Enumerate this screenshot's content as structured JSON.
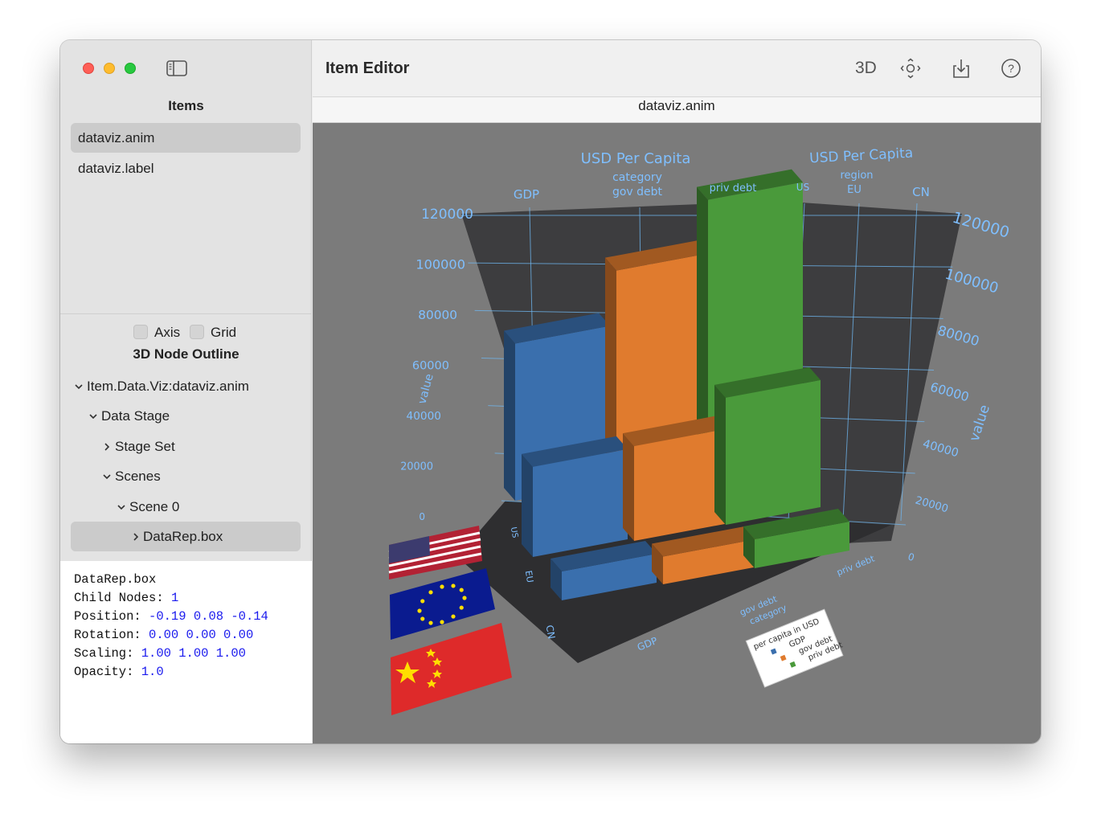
{
  "window": {
    "title": "Item Editor",
    "document_tab": "dataviz.anim"
  },
  "toolbar": {
    "title": "Item Editor",
    "mode_3d_label": "3D",
    "icons": [
      "recenter-icon",
      "export-icon",
      "help-icon"
    ]
  },
  "sidebar": {
    "items_title": "Items",
    "items": [
      {
        "label": "dataviz.anim",
        "selected": true
      },
      {
        "label": "dataviz.label",
        "selected": false
      }
    ],
    "axis_label": "Axis",
    "grid_label": "Grid",
    "axis_checked": false,
    "grid_checked": false,
    "outline_title": "3D Node Outline",
    "tree": [
      {
        "label": "Item.Data.Viz:dataviz.anim",
        "expanded": true,
        "depth": 0,
        "selected": false
      },
      {
        "label": "Data Stage",
        "expanded": true,
        "depth": 1,
        "selected": false
      },
      {
        "label": "Stage Set",
        "expanded": false,
        "depth": 2,
        "selected": false
      },
      {
        "label": "Scenes",
        "expanded": true,
        "depth": 2,
        "selected": false
      },
      {
        "label": "Scene 0",
        "expanded": true,
        "depth": 3,
        "selected": false
      },
      {
        "label": "DataRep.box",
        "expanded": false,
        "depth": 4,
        "selected": true
      }
    ]
  },
  "info": {
    "name": "DataRep.box",
    "child_nodes_label": "Child Nodes:",
    "child_nodes": "1",
    "position_label": "Position:",
    "position": "-0.19 0.08 -0.14",
    "rotation_label": "Rotation:",
    "rotation": "0.00 0.00 0.00",
    "scaling_label": "Scaling:",
    "scaling": "1.00 1.00 1.00",
    "opacity_label": "Opacity:",
    "opacity": "1.0"
  },
  "chart_data": {
    "type": "bar",
    "title": "USD Per Capita",
    "title_right": "USD Per Capita",
    "x_axis_title": "category",
    "z_axis_title": "region",
    "ylabel": "value",
    "categories": [
      "GDP",
      "gov debt",
      "priv debt"
    ],
    "regions": [
      "US",
      "EU",
      "CN"
    ],
    "ylim": [
      0,
      120000
    ],
    "yticks": [
      "0",
      "20000",
      "40000",
      "60000",
      "80000",
      "100000",
      "120000"
    ],
    "series": [
      {
        "name": "GDP",
        "color": "#3a6fad",
        "values": [
          69000,
          39000,
          12000
        ]
      },
      {
        "name": "gov debt",
        "color": "#e07b2e",
        "values": [
          94000,
          41000,
          11500
        ]
      },
      {
        "name": "priv debt",
        "color": "#4a9a3b",
        "values": [
          118000,
          55000,
          12000
        ]
      }
    ],
    "legend": {
      "title": "per capita in USD",
      "entries": [
        "GDP",
        "gov debt",
        "priv debt"
      ]
    },
    "grid": true
  }
}
